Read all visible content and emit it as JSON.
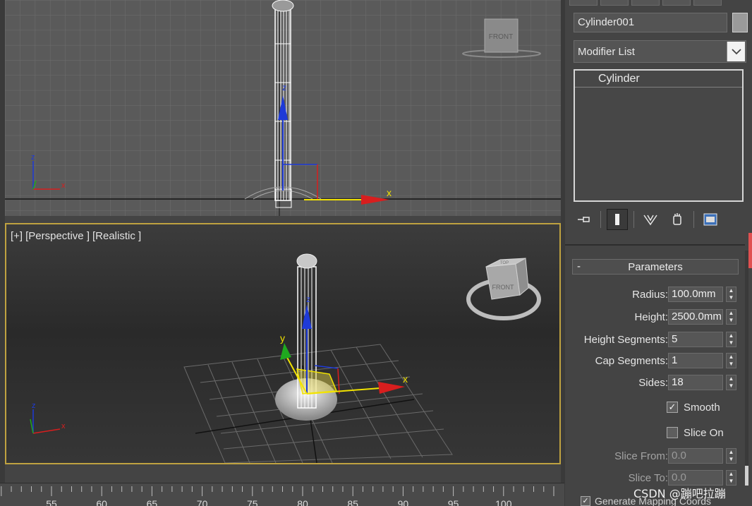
{
  "viewports": {
    "front": {
      "viewcube_label": "FRONT",
      "axis_x": "x",
      "axis_z": "z",
      "axis_y": "y"
    },
    "perspective": {
      "label_plus": "[+]",
      "label_view": "[Perspective ]",
      "label_shading": "[Realistic ]",
      "viewcube_front": "FRONT",
      "viewcube_top": "TOP",
      "axis_x": "x",
      "axis_y": "y",
      "axis_z": "z"
    }
  },
  "timeline": {
    "ticks": [
      "55",
      "60",
      "65",
      "70",
      "75",
      "80",
      "85",
      "90",
      "95",
      "100"
    ]
  },
  "command_panel": {
    "object_name": "Cylinder001",
    "object_color": "#9a9a9a",
    "modifier_list": "Modifier List",
    "dropdown_icon": "chevron-down",
    "stack_item": "Cylinder",
    "rollout": {
      "minus": "-",
      "title": "Parameters"
    },
    "params": {
      "radius": {
        "label": "Radius:",
        "value": "100.0mm"
      },
      "height": {
        "label": "Height:",
        "value": "2500.0mm"
      },
      "height_segments": {
        "label": "Height Segments:",
        "value": "5"
      },
      "cap_segments": {
        "label": "Cap Segments:",
        "value": "1"
      },
      "sides": {
        "label": "Sides:",
        "value": "18"
      },
      "smooth": {
        "label": "Smooth",
        "checked": true
      },
      "slice_on": {
        "label": "Slice On",
        "checked": false
      },
      "slice_from": {
        "label": "Slice From:",
        "value": "0.0"
      },
      "slice_to": {
        "label": "Slice To:",
        "value": "0.0"
      },
      "generate_mapping": {
        "label": "Generate Mapping Coords",
        "checked": true
      }
    },
    "checkmark": "✓",
    "spin_up": "▲",
    "spin_down": "▼"
  },
  "watermark": "CSDN @蹦吧拉蹦",
  "colors": {
    "viewport_active_border": "#bfa240",
    "axis_x": "#d81e1e",
    "axis_y": "#1fa81f",
    "axis_z": "#1e3ad8",
    "gizmo_yellow": "#f2e300"
  }
}
